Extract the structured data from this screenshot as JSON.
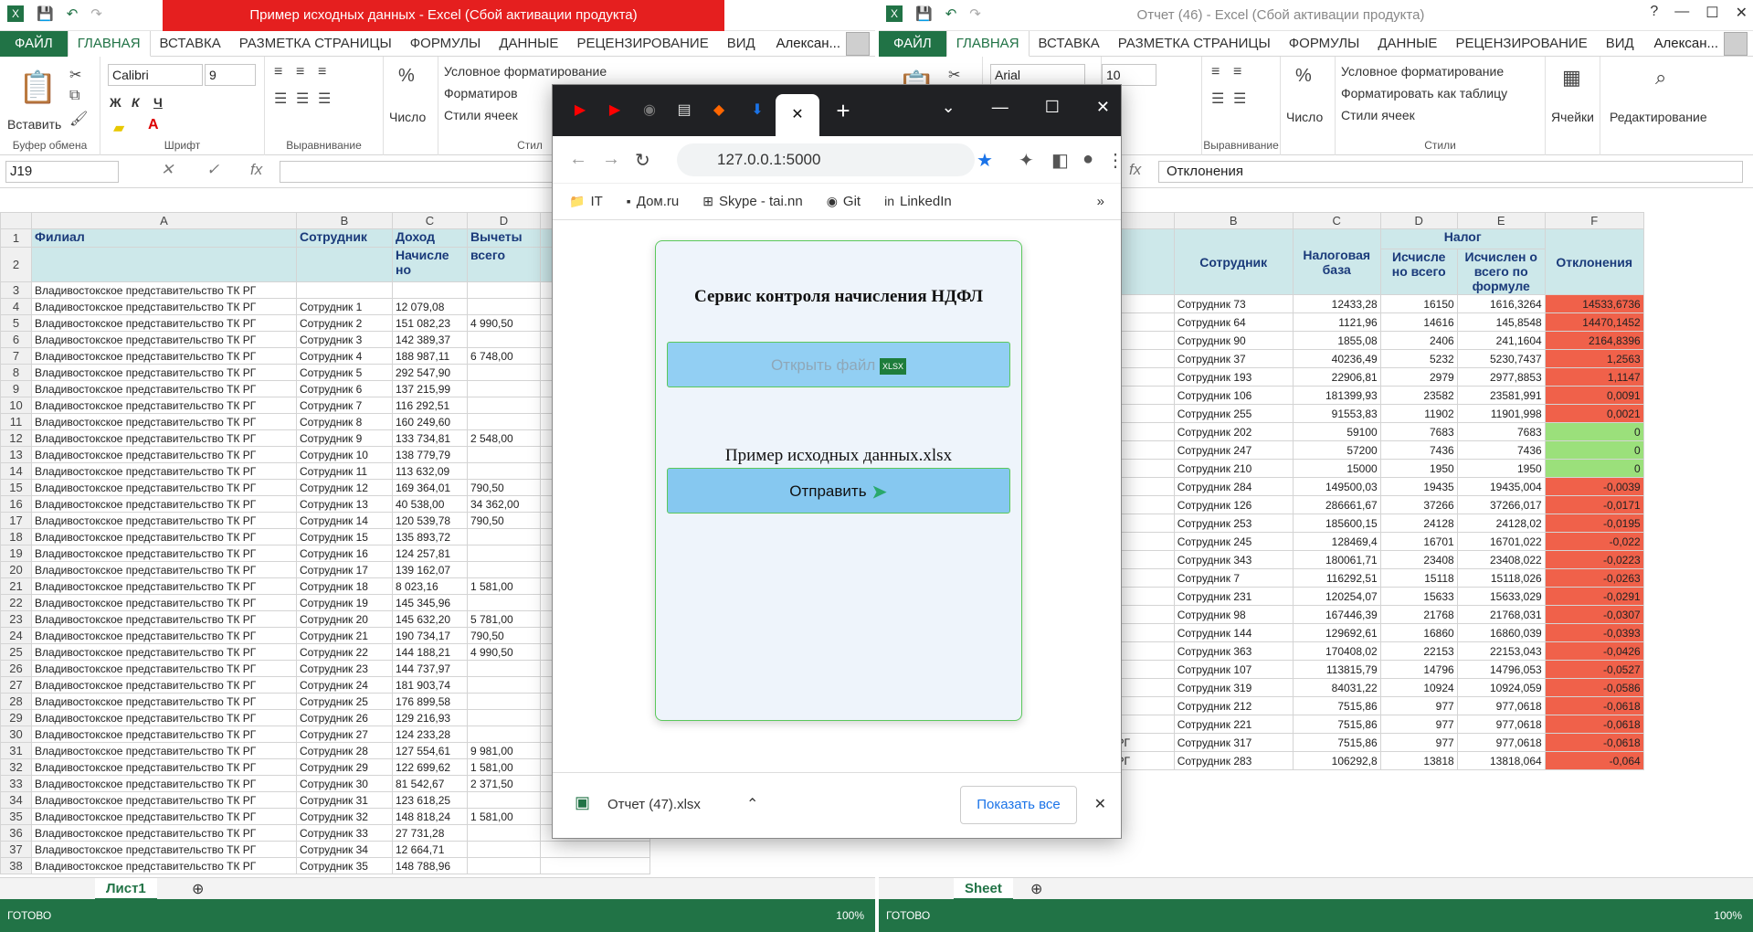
{
  "left": {
    "title": "Пример исходных данных -  Excel (Сбой активации продукта)",
    "tabs": [
      "ФАЙЛ",
      "ГЛАВНАЯ",
      "ВСТАВКА",
      "РАЗМЕТКА СТРАНИЦЫ",
      "ФОРМУЛЫ",
      "ДАННЫЕ",
      "РЕЦЕНЗИРОВАНИЕ",
      "ВИД"
    ],
    "user": "Алексан...",
    "font": "Calibri",
    "size": "9",
    "paste": "Вставить",
    "groups": {
      "clipboard": "Буфер обмена",
      "font": "Шрифт",
      "align": "Выравнивание",
      "number": "Число",
      "styles": "Стил"
    },
    "cond_format": "Условное форматирование",
    "format_table": "Форматиров",
    "cell_styles": "Стили ячеек",
    "namebox": "J19",
    "cols": [
      "A",
      "B",
      "C",
      "D"
    ],
    "header": {
      "filial": "Филиал",
      "employee": "Сотрудник",
      "income": "Доход",
      "accrued": "Начисле но",
      "deductions": "Вычеты",
      "deductions_total": "всего"
    },
    "rownums": [
      "1",
      "2",
      "3",
      "4",
      "5",
      "6",
      "7",
      "8",
      "9",
      "10",
      "11",
      "12",
      "13",
      "14",
      "15",
      "16",
      "17",
      "18",
      "19",
      "20",
      "21",
      "22",
      "23",
      "24",
      "25",
      "26",
      "27",
      "28",
      "29",
      "30",
      "31",
      "32",
      "33",
      "34",
      "35",
      "36",
      "37",
      "38"
    ],
    "rows": [
      [
        "Владивостокское представительство ТК РГ",
        "",
        "",
        ""
      ],
      [
        "Владивостокское представительство ТК РГ",
        "Сотрудник 1",
        "12 079,08",
        ""
      ],
      [
        "Владивостокское представительство ТК РГ",
        "Сотрудник 2",
        "151 082,23",
        "4 990,50"
      ],
      [
        "Владивостокское представительство ТК РГ",
        "Сотрудник 3",
        "142 389,37",
        ""
      ],
      [
        "Владивостокское представительство ТК РГ",
        "Сотрудник 4",
        "188 987,11",
        "6 748,00"
      ],
      [
        "Владивостокское представительство ТК РГ",
        "Сотрудник 5",
        "292 547,90",
        ""
      ],
      [
        "Владивостокское представительство ТК РГ",
        "Сотрудник 6",
        "137 215,99",
        ""
      ],
      [
        "Владивостокское представительство ТК РГ",
        "Сотрудник 7",
        "116 292,51",
        ""
      ],
      [
        "Владивостокское представительство ТК РГ",
        "Сотрудник 8",
        "160 249,60",
        ""
      ],
      [
        "Владивостокское представительство ТК РГ",
        "Сотрудник 9",
        "133 734,81",
        "2 548,00"
      ],
      [
        "Владивостокское представительство ТК РГ",
        "Сотрудник 10",
        "138 779,79",
        ""
      ],
      [
        "Владивостокское представительство ТК РГ",
        "Сотрудник 11",
        "113 632,09",
        ""
      ],
      [
        "Владивостокское представительство ТК РГ",
        "Сотрудник 12",
        "169 364,01",
        "790,50"
      ],
      [
        "Владивостокское представительство ТК РГ",
        "Сотрудник 13",
        "40 538,00",
        "34 362,00"
      ],
      [
        "Владивостокское представительство ТК РГ",
        "Сотрудник 14",
        "120 539,78",
        "790,50"
      ],
      [
        "Владивостокское представительство ТК РГ",
        "Сотрудник 15",
        "135 893,72",
        ""
      ],
      [
        "Владивостокское представительство ТК РГ",
        "Сотрудник 16",
        "124 257,81",
        ""
      ],
      [
        "Владивостокское представительство ТК РГ",
        "Сотрудник 17",
        "139 162,07",
        ""
      ],
      [
        "Владивостокское представительство ТК РГ",
        "Сотрудник 18",
        "8 023,16",
        "1 581,00"
      ],
      [
        "Владивостокское представительство ТК РГ",
        "Сотрудник 19",
        "145 345,96",
        ""
      ],
      [
        "Владивостокское представительство ТК РГ",
        "Сотрудник 20",
        "145 632,20",
        "5 781,00"
      ],
      [
        "Владивостокское представительство ТК РГ",
        "Сотрудник 21",
        "190 734,17",
        "790,50"
      ],
      [
        "Владивостокское представительство ТК РГ",
        "Сотрудник 22",
        "144 188,21",
        "4 990,50"
      ],
      [
        "Владивостокское представительство ТК РГ",
        "Сотрудник 23",
        "144 737,97",
        ""
      ],
      [
        "Владивостокское представительство ТК РГ",
        "Сотрудник 24",
        "181 903,74",
        ""
      ],
      [
        "Владивостокское представительство ТК РГ",
        "Сотрудник 25",
        "176 899,58",
        ""
      ],
      [
        "Владивостокское представительство ТК РГ",
        "Сотрудник 26",
        "129 216,93",
        ""
      ],
      [
        "Владивостокское представительство ТК РГ",
        "Сотрудник 27",
        "124 233,28",
        ""
      ],
      [
        "Владивостокское представительство ТК РГ",
        "Сотрудник 28",
        "127 554,61",
        "9 981,00"
      ],
      [
        "Владивостокское представительство ТК РГ",
        "Сотрудник 29",
        "122 699,62",
        "1 581,00"
      ],
      [
        "Владивостокское представительство ТК РГ",
        "Сотрудник 30",
        "81 542,67",
        "2 371,50"
      ],
      [
        "Владивостокское представительство ТК РГ",
        "Сотрудник 31",
        "123 618,25",
        ""
      ],
      [
        "Владивостокское представительство ТК РГ",
        "Сотрудник 32",
        "148 818,24",
        "1 581,00"
      ],
      [
        "Владивостокское представительство ТК РГ",
        "Сотрудник 33",
        "27 731,28",
        ""
      ],
      [
        "Владивостокское представительство ТК РГ",
        "Сотрудник 34",
        "12 664,71",
        ""
      ],
      [
        "Владивостокское представительство ТК РГ",
        "Сотрудник 35",
        "148 788,96",
        ""
      ]
    ],
    "sheet": "Лист1",
    "status": "ГОТОВО",
    "zoom": "100%"
  },
  "right": {
    "title": "Отчет (46) - Excel (Сбой активации продукта)",
    "tabs": [
      "ФАЙЛ",
      "ГЛАВНАЯ",
      "ВСТАВКА",
      "РАЗМЕТКА СТРАНИЦЫ",
      "ФОРМУЛЫ",
      "ДАННЫЕ",
      "РЕЦЕНЗИРОВАНИЕ",
      "ВИД"
    ],
    "user": "Алексан...",
    "font": "Arial",
    "size": "10",
    "number": "Число",
    "cond_format": "Условное форматирование",
    "format_table": "Форматировать как таблицу",
    "cell_styles": "Стили ячеек",
    "cells": "Ячейки",
    "editing": "Редактирование",
    "groups": {
      "align": "Выравнивание",
      "styles": "Стили"
    },
    "formula": "Отклонения",
    "cols": [
      "B",
      "C",
      "D",
      "E",
      "F"
    ],
    "header": {
      "employee": "Сотрудник",
      "base": "Налоговая база",
      "tax": "Налог",
      "calc": "Исчисле но всего",
      "calc_formula": "Исчислен о всего по формуле",
      "dev": "Отклонения"
    },
    "rows": [
      [
        "ельство ТК РГ",
        "Сотрудник 73",
        "12433,28",
        "16150",
        "1616,3264",
        "14533,6736",
        "pos"
      ],
      [
        "ельство ТК РГ",
        "Сотрудник 64",
        "1121,96",
        "14616",
        "145,8548",
        "14470,1452",
        "pos"
      ],
      [
        "ельство ТК РГ",
        "Сотрудник 90",
        "1855,08",
        "2406",
        "241,1604",
        "2164,8396",
        "pos"
      ],
      [
        "ельство ТК РГ",
        "Сотрудник 37",
        "40236,49",
        "5232",
        "5230,7437",
        "1,2563",
        "pos"
      ],
      [
        "ельство ТК РГ",
        "Сотрудник 193",
        "22906,81",
        "2979",
        "2977,8853",
        "1,1147",
        "pos"
      ],
      [
        "ельство ТК РГ",
        "Сотрудник 106",
        "181399,93",
        "23582",
        "23581,991",
        "0,0091",
        "pos"
      ],
      [
        "ельство ТК РГ",
        "Сотрудник 255",
        "91553,83",
        "11902",
        "11901,998",
        "0,0021",
        "pos"
      ],
      [
        "ельство ТК РГ",
        "Сотрудник 202",
        "59100",
        "7683",
        "7683",
        "0",
        "zero"
      ],
      [
        "ельство ТК РГ",
        "Сотрудник 247",
        "57200",
        "7436",
        "7436",
        "0",
        "zero"
      ],
      [
        "ельство ТК РГ",
        "Сотрудник 210",
        "15000",
        "1950",
        "1950",
        "0",
        "zero"
      ],
      [
        "ельство ТК РГ",
        "Сотрудник 284",
        "149500,03",
        "19435",
        "19435,004",
        "-0,0039",
        "neg"
      ],
      [
        "ельство ТК РГ",
        "Сотрудник 126",
        "286661,67",
        "37266",
        "37266,017",
        "-0,0171",
        "neg"
      ],
      [
        "ельство ТК РГ",
        "Сотрудник 253",
        "185600,15",
        "24128",
        "24128,02",
        "-0,0195",
        "neg"
      ],
      [
        "ельство ТК РГ",
        "Сотрудник 245",
        "128469,4",
        "16701",
        "16701,022",
        "-0,022",
        "neg"
      ],
      [
        "ельство ТК РГ",
        "Сотрудник 343",
        "180061,71",
        "23408",
        "23408,022",
        "-0,0223",
        "neg"
      ],
      [
        "ельство ТК РГ",
        "Сотрудник 7",
        "116292,51",
        "15118",
        "15118,026",
        "-0,0263",
        "neg"
      ],
      [
        "ельство ТК РГ",
        "Сотрудник 231",
        "120254,07",
        "15633",
        "15633,029",
        "-0,0291",
        "neg"
      ],
      [
        "ельство ТК РГ",
        "Сотрудник 98",
        "167446,39",
        "21768",
        "21768,031",
        "-0,0307",
        "neg"
      ],
      [
        "ельство ТК РГ",
        "Сотрудник 144",
        "129692,61",
        "16860",
        "16860,039",
        "-0,0393",
        "neg"
      ],
      [
        "ельство ТК РГ",
        "Сотрудник 363",
        "170408,02",
        "22153",
        "22153,043",
        "-0,0426",
        "neg"
      ],
      [
        "ельство ТК РГ",
        "Сотрудник 107",
        "113815,79",
        "14796",
        "14796,053",
        "-0,0527",
        "neg"
      ],
      [
        "ельство ТК РГ",
        "Сотрудник 319",
        "84031,22",
        "10924",
        "10924,059",
        "-0,0586",
        "neg"
      ],
      [
        "ельство ТК РГ",
        "Сотрудник 212",
        "7515,86",
        "977",
        "977,0618",
        "-0,0618",
        "neg"
      ],
      [
        "ельство ТК РГ",
        "Сотрудник 221",
        "7515,86",
        "977",
        "977,0618",
        "-0,0618",
        "neg"
      ],
      [
        "Владивостокское представительство ТК РГ",
        "Сотрудник 317",
        "7515,86",
        "977",
        "977,0618",
        "-0,0618",
        "neg"
      ],
      [
        "Владивостокское представительство ТК РГ",
        "Сотрудник 283",
        "106292,8",
        "13818",
        "13818,064",
        "-0,064",
        "neg"
      ]
    ],
    "rownums_tail": [
      "200",
      "201"
    ],
    "sheet": "Sheet",
    "status": "ГОТОВО",
    "zoom": "100%"
  },
  "chrome": {
    "url": "127.0.0.1:5000",
    "bookmarks": [
      "IT",
      "Дом.ru",
      "Skype - tai.nn",
      "Git",
      "LinkedIn"
    ],
    "card_title": "Сервис контроля начисления НДФЛ",
    "open_btn": "Открыть файл",
    "file_name": "Пример исходных данных.xlsx",
    "send_btn": "Отправить",
    "download": "Отчет (47).xlsx",
    "show_all": "Показать все"
  }
}
